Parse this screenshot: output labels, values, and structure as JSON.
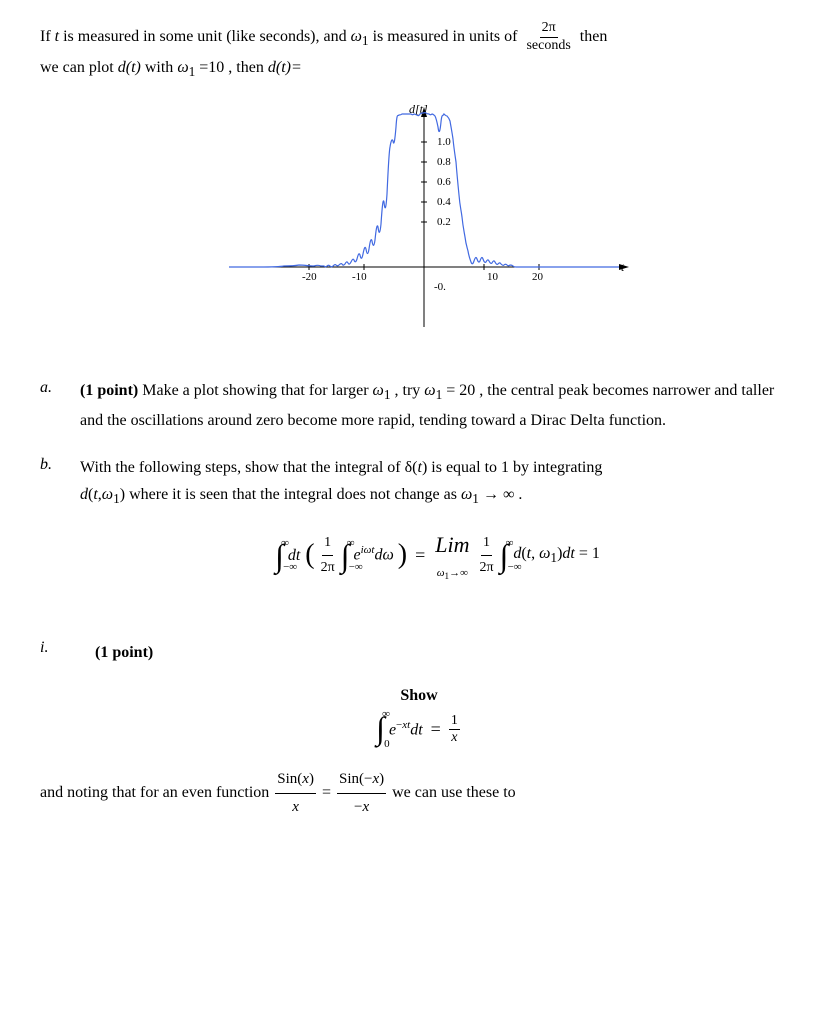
{
  "intro": {
    "text1": "If ",
    "t": "t",
    "text2": " is measured in some unit (like seconds), and ",
    "omega1": "ω",
    "sub1": "1",
    "text3": " is measured in units of",
    "frac_num": "2π",
    "frac_den": "seconds",
    "then": "then",
    "text4": "we can plot ",
    "dt": "d(t)",
    "text5": " with ",
    "omega1_2": "ω",
    "sub2": "1",
    "text6": " =10 , then ",
    "dt2": "d(t)=",
    "graph_label_y": "d[t]",
    "graph_label_x": "t",
    "y_vals": [
      "1.0",
      "0.8",
      "0.6",
      "0.4",
      "0.2"
    ],
    "x_vals": [
      "-20",
      "-10",
      "10",
      "20"
    ],
    "y_neg": "-0."
  },
  "section_a": {
    "label": "a.",
    "point": "(1 point)",
    "text": "Make a plot showing that for larger ω₁ , try ω₁ = 20 , the central peak becomes narrower and taller and the oscillations around zero become more rapid, tending toward a Dirac Delta function."
  },
  "section_b": {
    "label": "b.",
    "text1": "With the following steps, show that the integral of δ(t) is equal to 1 by integrating",
    "text2": "d(t,ω₁) where it is seen that the integral does not change as ω₁ → ∞ ."
  },
  "section_i": {
    "label": "i.",
    "point": "(1 point)",
    "show": "Show",
    "and_noting": "and noting that for an even function",
    "we_can": "we can use these to"
  },
  "colors": {
    "blue": "#4169e1",
    "black": "#000000"
  }
}
